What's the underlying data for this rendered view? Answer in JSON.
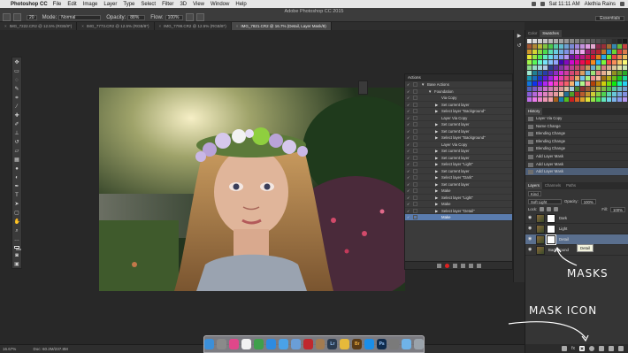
{
  "menubar": {
    "app_name": "Photoshop CC",
    "items": [
      "File",
      "Edit",
      "Image",
      "Layer",
      "Type",
      "Select",
      "Filter",
      "3D",
      "View",
      "Window",
      "Help"
    ],
    "clock": "Sat 11:11 AM",
    "user": "Alethia Rains"
  },
  "options_bar": {
    "window_title": "Adobe Photoshop CC 2015",
    "brush_size": "20",
    "mode_label": "Mode:",
    "mode_value": "Normal",
    "opacity_label": "Opacity:",
    "opacity_value": "88%",
    "flow_label": "Flow:",
    "flow_value": "100%",
    "workspace": "Essentials"
  },
  "doc_tabs": [
    {
      "label": "IMG_7222.CR2 @ 12.5% (RGB/8*)",
      "active": false
    },
    {
      "label": "IMG_7773.CR2 @ 12.5% (RGB/8*)",
      "active": false
    },
    {
      "label": "IMG_7799.CR2 @ 12.5% (RGB/8*)",
      "active": false
    },
    {
      "label": "IMG_7821.CR2 @ 16.7% (Detail, Layer Mask/8)",
      "active": true
    }
  ],
  "actions_panel": {
    "title": "Actions",
    "rows": [
      {
        "label": "Base Actions",
        "indent": 0,
        "arrow": "▼"
      },
      {
        "label": "Foundation",
        "indent": 1,
        "arrow": "▼"
      },
      {
        "label": "Via Copy",
        "indent": 2,
        "arrow": ""
      },
      {
        "label": "Set current layer",
        "indent": 2,
        "arrow": "▶"
      },
      {
        "label": "Select layer \"Background\"",
        "indent": 2,
        "arrow": "▶"
      },
      {
        "label": "Layer Via Copy",
        "indent": 2,
        "arrow": ""
      },
      {
        "label": "Set current layer",
        "indent": 2,
        "arrow": "▶"
      },
      {
        "label": "Set current layer",
        "indent": 2,
        "arrow": "▶"
      },
      {
        "label": "Select layer \"Background\"",
        "indent": 2,
        "arrow": "▶"
      },
      {
        "label": "Layer Via Copy",
        "indent": 2,
        "arrow": ""
      },
      {
        "label": "Set current layer",
        "indent": 2,
        "arrow": "▶"
      },
      {
        "label": "Set current layer",
        "indent": 2,
        "arrow": "▶"
      },
      {
        "label": "Select layer \"Light\"",
        "indent": 2,
        "arrow": "▶"
      },
      {
        "label": "Set current layer",
        "indent": 2,
        "arrow": "▶"
      },
      {
        "label": "Select layer \"Dark\"",
        "indent": 2,
        "arrow": "▶"
      },
      {
        "label": "Set current layer",
        "indent": 2,
        "arrow": "▶"
      },
      {
        "label": "Make",
        "indent": 2,
        "arrow": "▶"
      },
      {
        "label": "Select layer \"Light\"",
        "indent": 2,
        "arrow": "▶"
      },
      {
        "label": "Make",
        "indent": 2,
        "arrow": "▶"
      },
      {
        "label": "Select layer \"Detail\"",
        "indent": 2,
        "arrow": "▶"
      },
      {
        "label": "Make",
        "indent": 2,
        "arrow": "",
        "selected": true
      }
    ]
  },
  "right_panel": {
    "color_tabs": [
      "Color",
      "Swatches"
    ],
    "history_tab": "History",
    "history_rows": [
      {
        "label": "Layer Via Copy"
      },
      {
        "label": "Name Change"
      },
      {
        "label": "Blending Change"
      },
      {
        "label": "Blending Change"
      },
      {
        "label": "Blending Change"
      },
      {
        "label": "Add Layer Mask"
      },
      {
        "label": "Add Layer Mask"
      },
      {
        "label": "Add Layer Mask",
        "selected": true
      }
    ],
    "layers_tabs": [
      "Layers",
      "Channels",
      "Paths"
    ],
    "kind_label": "Kind",
    "blend_mode": "Soft Light",
    "opacity_label": "Opacity:",
    "opacity_value": "100%",
    "lock_label": "Lock:",
    "fill_label": "Fill:",
    "fill_value": "100%",
    "layers": [
      {
        "name": "Dark",
        "selected": false
      },
      {
        "name": "Light",
        "selected": false
      },
      {
        "name": "Detail",
        "selected": true
      },
      {
        "name": "Background",
        "selected": false
      }
    ],
    "tooltip": "Detail"
  },
  "annotations": {
    "masks": "MASKS",
    "mask_icon": "MASK ICON"
  },
  "status_bar": {
    "zoom": "16.67%",
    "doc_size": "Doc: 60.2M/237.8M"
  },
  "mac_dock": {
    "apps": [
      {
        "name": "Finder",
        "color": "#3b8fd9"
      },
      {
        "name": "Launchpad",
        "color": "#8a8a8a"
      },
      {
        "name": "iTunes",
        "color": "#e0478a"
      },
      {
        "name": "Calendar",
        "color": "#f2f2f2"
      },
      {
        "name": "Chrome",
        "color": "#3fa04b"
      },
      {
        "name": "Safari",
        "color": "#2e8be0"
      },
      {
        "name": "Mail",
        "color": "#4aa2e8"
      },
      {
        "name": "Preview",
        "color": "#6a9ed8"
      },
      {
        "name": "Acrobat",
        "color": "#c0282d"
      },
      {
        "name": "Contacts",
        "color": "#a37b50"
      },
      {
        "name": "Lightroom",
        "color": "#2b3b4f"
      },
      {
        "name": "Photos",
        "color": "#e6b93a"
      },
      {
        "name": "Bridge",
        "color": "#5a3b17"
      },
      {
        "name": "App Store",
        "color": "#1b8ee8"
      },
      {
        "name": "Photoshop",
        "color": "#0f2b4d"
      },
      {
        "name": "System Preferences",
        "color": "#7a7a7a"
      },
      {
        "name": "Folder",
        "color": "#6fb3e8"
      },
      {
        "name": "Trash",
        "color": "#9aa3ab"
      }
    ],
    "labels": {
      "Lightroom": "Lr",
      "Bridge": "Br",
      "Photoshop": "Ps"
    }
  },
  "colors": {
    "accent_selection": "#5a7cae",
    "panel_bg": "#353535",
    "workspace_bg": "#282828"
  }
}
